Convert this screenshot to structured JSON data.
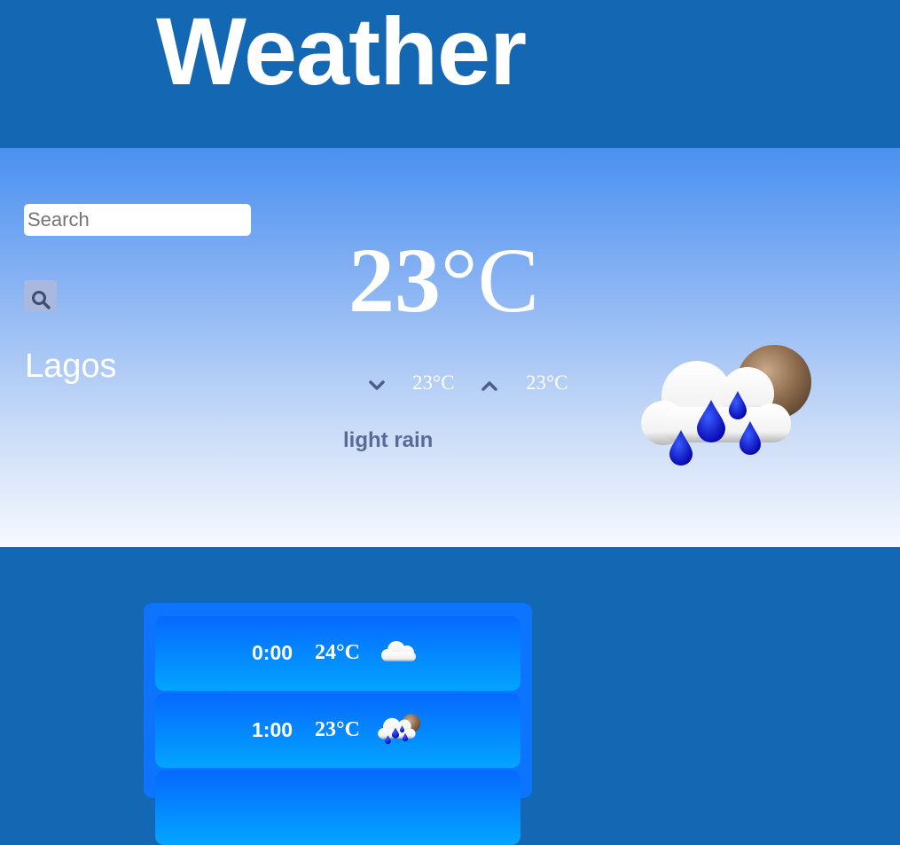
{
  "header": {
    "title": "Weather"
  },
  "search": {
    "placeholder": "Search",
    "value": ""
  },
  "current": {
    "city": "Lagos",
    "temp": "23",
    "unit": "°C",
    "min": "23°C",
    "max": "23°C",
    "description": "light rain",
    "icon": "cloud-rain-sun-icon"
  },
  "hourly": [
    {
      "time": "0:00",
      "temp": "24°C",
      "icon": "cloud-icon"
    },
    {
      "time": "1:00",
      "temp": "23°C",
      "icon": "cloud-rain-sun-icon"
    }
  ],
  "colors": {
    "header_bg": "#1467b3",
    "hero_top": "#4a90f0",
    "hero_bottom": "#f7f9fe",
    "card_bg": "#0c74ff",
    "row_top": "#0669ff",
    "row_bottom": "#03a5ff",
    "description": "#5a6a98"
  }
}
